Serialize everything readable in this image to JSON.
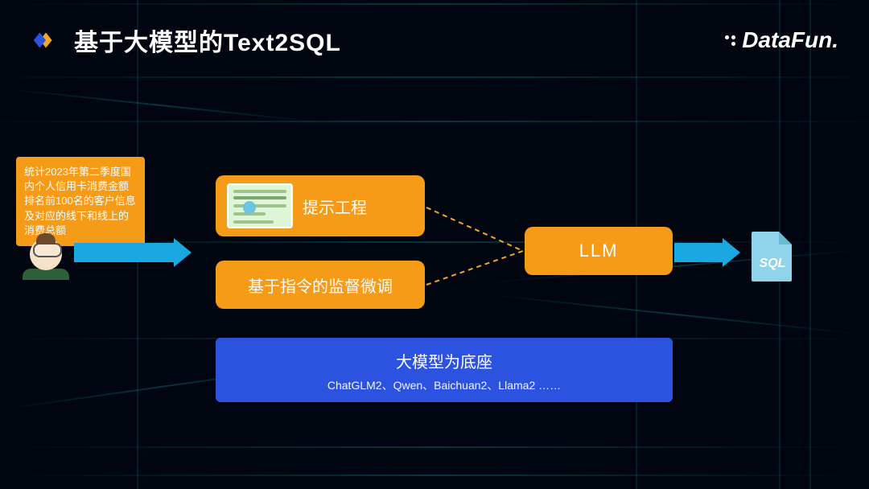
{
  "title": "基于大模型的Text2SQL",
  "brand": "DataFun.",
  "speech_bubble": "统计2023年第二季度国内个人信用卡消费金额排名前100名的客户信息及对应的线下和线上的消费总额",
  "prompt_engineering": "提示工程",
  "sft": "基于指令的监督微调",
  "llm": "LLM",
  "base": {
    "title": "大模型为底座",
    "subtitle": "ChatGLM2、Qwen、Baichuan2、Llama2 ……"
  },
  "output_label": "SQL",
  "colors": {
    "accent_orange": "#f59b17",
    "accent_blue": "#2c52e0",
    "arrow_blue": "#1ba8e0"
  }
}
